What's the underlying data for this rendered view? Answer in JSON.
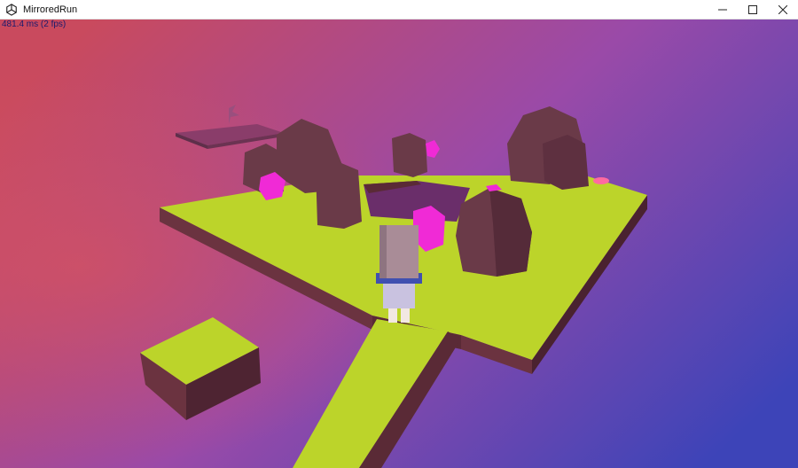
{
  "window": {
    "title": "MirroredRun",
    "icon": "unity-logo-icon",
    "controls": [
      "minimize-icon",
      "maximize-icon",
      "close-icon"
    ]
  },
  "game": {
    "fps_readout": "481.4 ms (2 fps)",
    "colors": {
      "background_left": "#c94a5e",
      "background_center": "#9a4aa8",
      "background_right": "#3d44b8",
      "grass_top": "#bcd42a",
      "dirt_side": "#6b3340",
      "rock": "#6a3a48",
      "gem": "#f02ad6",
      "character_head": "#a98c97",
      "character_shirt": "#4050b0"
    }
  }
}
